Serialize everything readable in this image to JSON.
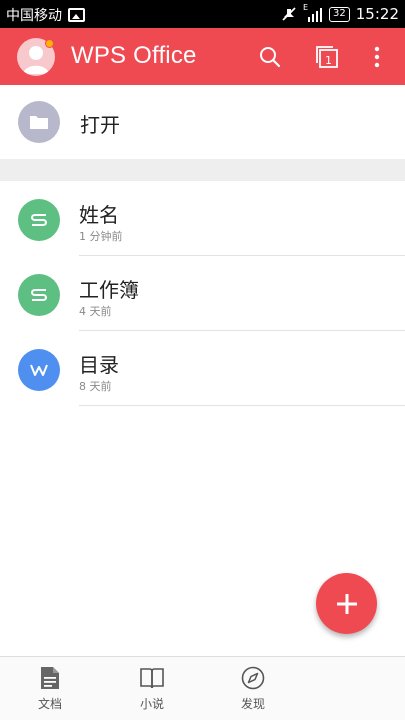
{
  "status_bar": {
    "carrier": "中国移动",
    "signal_label": "E",
    "battery": "32",
    "time": "15:22"
  },
  "app_bar": {
    "title": "WPS Office"
  },
  "open_row": {
    "label": "打开"
  },
  "files": [
    {
      "name": "姓名",
      "time": "1 分钟前",
      "type_letter": "S",
      "color": "#5dbf82"
    },
    {
      "name": "工作簿",
      "time": "4 天前",
      "type_letter": "S",
      "color": "#5dbf82"
    },
    {
      "name": "目录",
      "time": "8 天前",
      "type_letter": "W",
      "color": "#4f8ff0"
    }
  ],
  "bottom_nav": {
    "docs": "文档",
    "novel": "小说",
    "discover": "发现"
  },
  "colors": {
    "accent": "#ef4a52",
    "spreadsheet": "#5dbf82",
    "writer": "#4f8ff0",
    "folder": "#b8b8cc"
  }
}
